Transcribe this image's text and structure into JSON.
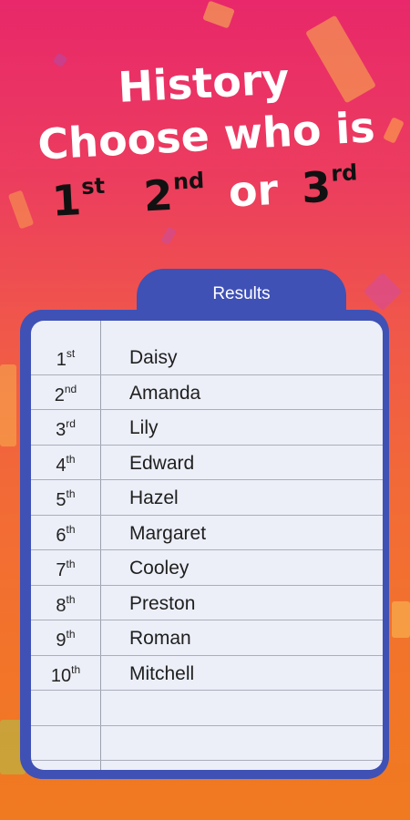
{
  "heading": {
    "line1": "History",
    "line2": "Choose who is",
    "ordinals": [
      {
        "num": "1",
        "sup": "st"
      },
      {
        "num": "2",
        "sup": "nd"
      },
      {
        "num": "3",
        "sup": "rd"
      }
    ],
    "or_word": "or"
  },
  "results": {
    "tab_label": "Results",
    "rows": [
      {
        "num": "1",
        "sup": "st",
        "name": "Daisy"
      },
      {
        "num": "2",
        "sup": "nd",
        "name": "Amanda"
      },
      {
        "num": "3",
        "sup": "rd",
        "name": "Lily"
      },
      {
        "num": "4",
        "sup": "th",
        "name": "Edward"
      },
      {
        "num": "5",
        "sup": "th",
        "name": "Hazel"
      },
      {
        "num": "6",
        "sup": "th",
        "name": "Margaret"
      },
      {
        "num": "7",
        "sup": "th",
        "name": "Cooley"
      },
      {
        "num": "8",
        "sup": "th",
        "name": "Preston"
      },
      {
        "num": "9",
        "sup": "th",
        "name": "Roman"
      },
      {
        "num": "10",
        "sup": "th",
        "name": "Mitchell"
      },
      {
        "num": "",
        "sup": "",
        "name": ""
      },
      {
        "num": "",
        "sup": "",
        "name": ""
      }
    ]
  },
  "colors": {
    "panel": "#3f51b5",
    "sheet": "#eceff8",
    "heading_text": "#ffffff",
    "ordinal_text": "#111111"
  }
}
